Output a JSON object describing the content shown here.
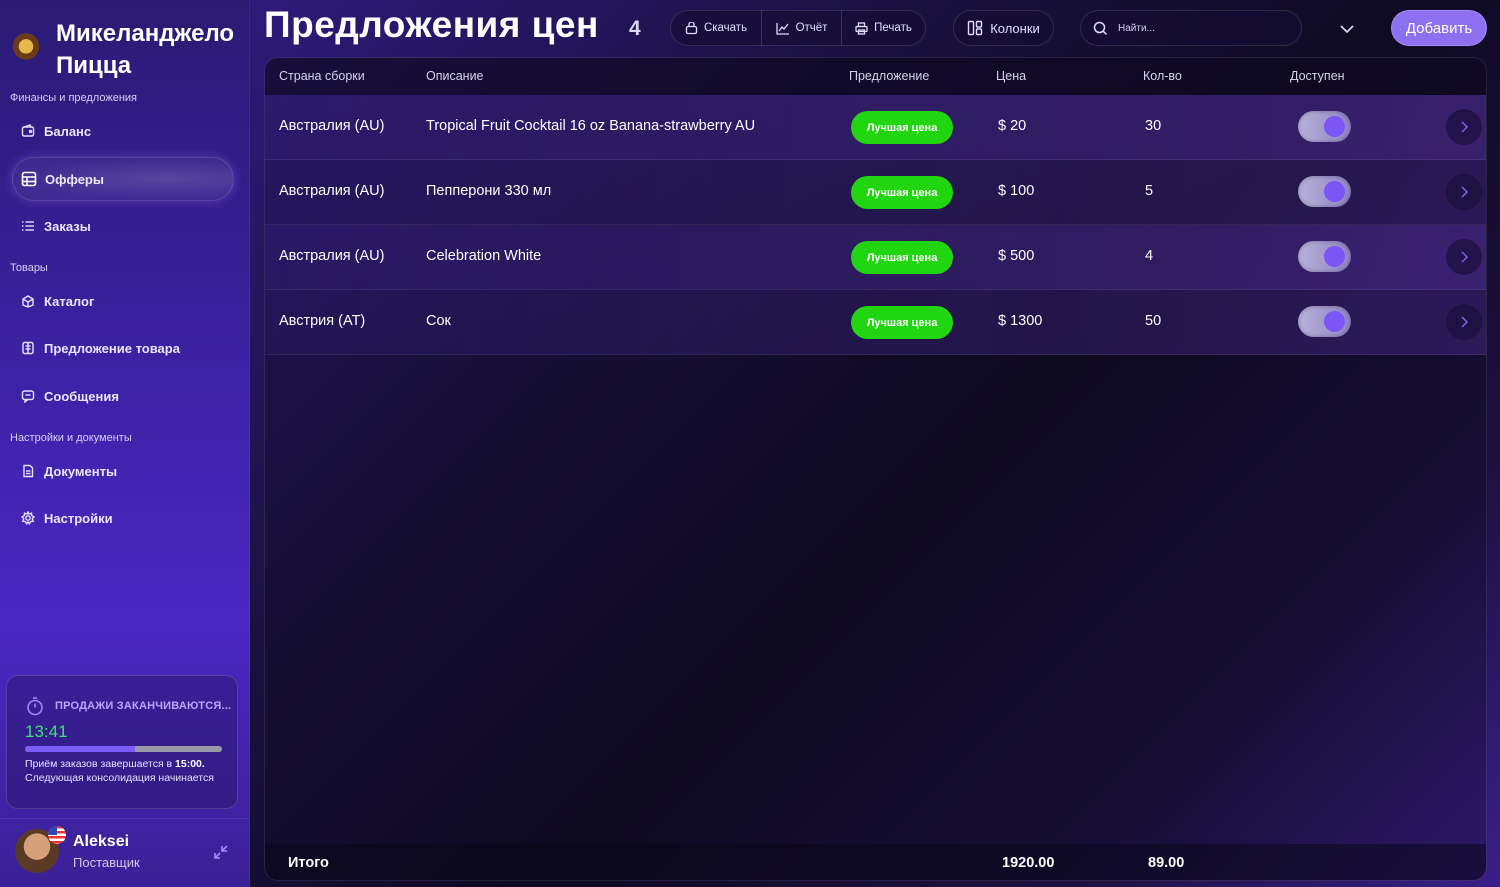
{
  "brand": {
    "title": "Микеланджело Пицца",
    "logo_icon": "pizza-logo-icon"
  },
  "sidebar": {
    "sections": [
      "Финансы и предложения",
      "Товары",
      "Настройки и документы"
    ],
    "items": [
      {
        "label": "Баланс",
        "icon": "wallet-icon"
      },
      {
        "label": "Офферы",
        "icon": "table-icon",
        "active": true
      },
      {
        "label": "Заказы",
        "icon": "list-icon"
      },
      {
        "label": "Каталог",
        "icon": "catalog-icon"
      },
      {
        "label": "Предложение товара",
        "icon": "product-offer-icon"
      },
      {
        "label": "Сообщения",
        "icon": "message-icon"
      },
      {
        "label": "Документы",
        "icon": "document-icon"
      },
      {
        "label": "Настройки",
        "icon": "gear-icon"
      }
    ]
  },
  "timer": {
    "title": "ПРОДАЖИ ЗАКАНЧИВАЮТСЯ...",
    "time": "13:41",
    "progress": 0.56,
    "text_prefix": "Приём заказов завершается в ",
    "text_time": "15:00.",
    "text_suffix": "Следующая консолидация начинается"
  },
  "user": {
    "name": "Aleksei",
    "role": "Поставщик"
  },
  "header": {
    "title": "Предложения цен",
    "count": "4",
    "download_label": "Скачать",
    "report_label": "Отчёт",
    "print_label": "Печать",
    "columns_label": "Колонки",
    "search_placeholder": "Найти...",
    "add_label": "Добавить"
  },
  "table": {
    "columns": [
      "Страна сборки",
      "Описание",
      "Предложение",
      "Цена",
      "Кол-во",
      "Доступен"
    ],
    "rows": [
      {
        "country": "Австралия (AU)",
        "description": "Tropical Fruit Cocktail 16 oz Banana-strawberry AU",
        "offer": "Лучшая цена",
        "price": "$ 20",
        "qty": "30",
        "available": true
      },
      {
        "country": "Австралия (AU)",
        "description": "Пепперони 330 мл",
        "offer": "Лучшая цена",
        "price": "$ 100",
        "qty": "5",
        "available": true
      },
      {
        "country": "Австралия (AU)",
        "description": "Celebration White",
        "offer": "Лучшая цена",
        "price": "$ 500",
        "qty": "4",
        "available": true
      },
      {
        "country": "Австрия (AT)",
        "description": "Сок",
        "offer": "Лучшая цена",
        "price": "$ 1300",
        "qty": "50",
        "available": true
      }
    ],
    "footer": {
      "label": "Итого",
      "price_total": "1920.00",
      "qty_total": "89.00"
    }
  },
  "colors": {
    "accent": "#8c70ef",
    "badge": "#22d511",
    "timer_time": "#3ee07a",
    "toggle_knob": "#7b55f5"
  }
}
